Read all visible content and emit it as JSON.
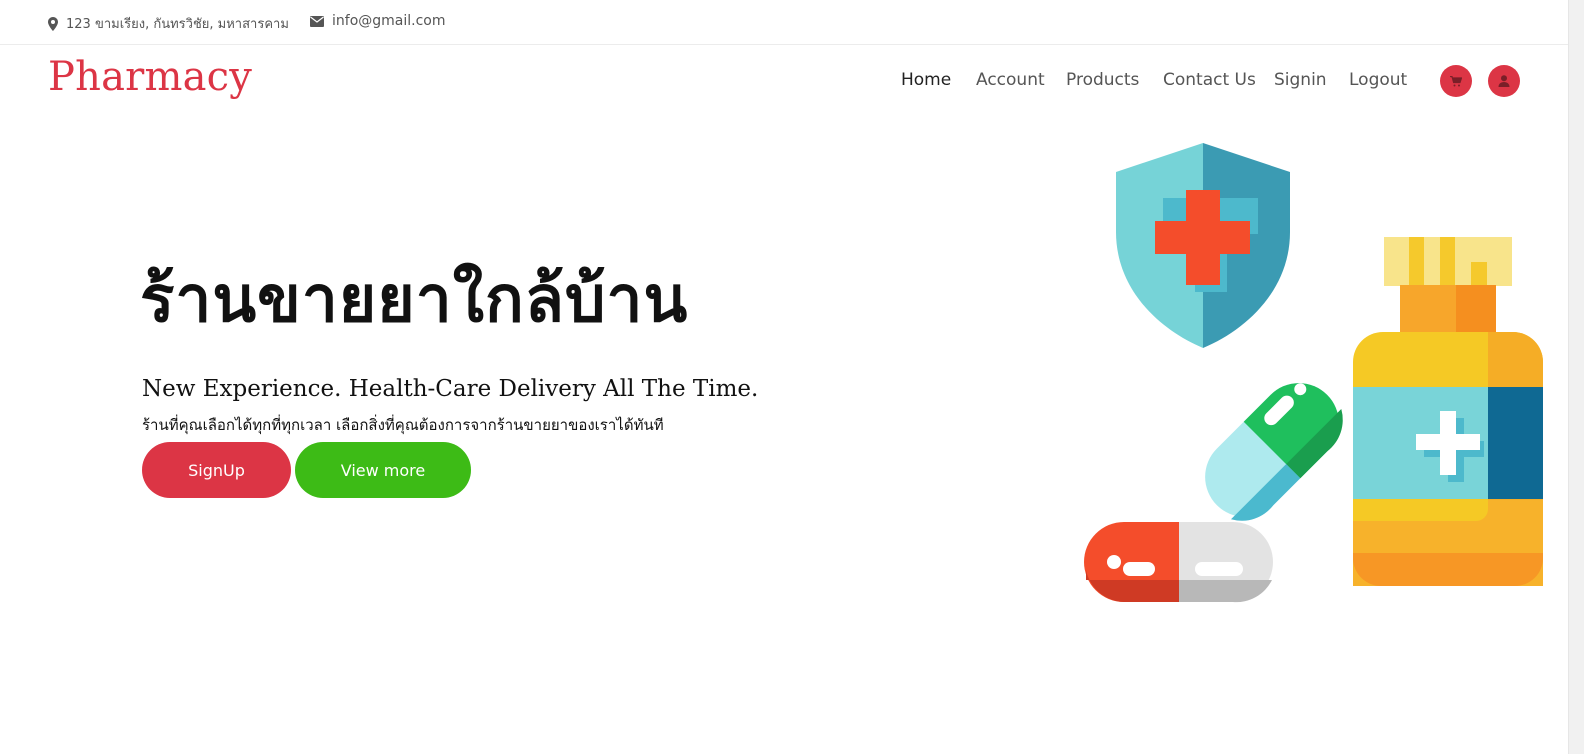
{
  "topbar": {
    "address": "123 ขามเรียง, กันทรวิชัย, มหาสารคาม",
    "email": "info@gmail.com",
    "address_icon": "map-marker-icon",
    "email_icon": "envelope-icon"
  },
  "brand": {
    "name": "Pharmacy",
    "color": "#dc3545"
  },
  "nav": {
    "items": [
      {
        "label": "Home",
        "active": true
      },
      {
        "label": "Account"
      },
      {
        "label": "Products"
      },
      {
        "label": "Contact Us"
      },
      {
        "label": "Signin"
      },
      {
        "label": "Logout"
      }
    ],
    "cart_icon": "shopping-cart-icon",
    "user_icon": "user-icon"
  },
  "hero": {
    "title": "ร้านขายยาใกล้บ้าน",
    "subtitle": "New Experience. Health-Care Delivery All The Time.",
    "description": "ร้านที่คุณเลือกได้ทุกที่ทุกเวลา เลือกสิ่งที่คุณต้องการจากร้านขายยาของเราได้ทันที",
    "signup_label": "SignUp",
    "more_label": "View more",
    "signup_color": "#dc3545",
    "more_color": "#3dbb16"
  },
  "illustration": {
    "icon": "pharmacy-illustration"
  }
}
